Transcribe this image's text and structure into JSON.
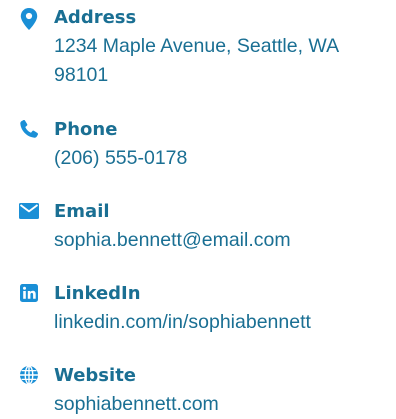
{
  "colors": {
    "accent": "#1a8fd6",
    "text": "#1a6f93",
    "background": "#ffffff"
  },
  "contacts": [
    {
      "icon": "location-pin-icon",
      "label": "Address",
      "value": "1234 Maple Avenue, Seattle, WA 98101"
    },
    {
      "icon": "phone-icon",
      "label": "Phone",
      "value": "(206) 555-0178"
    },
    {
      "icon": "envelope-icon",
      "label": "Email",
      "value": "sophia.bennett@email.com"
    },
    {
      "icon": "linkedin-icon",
      "label": "LinkedIn",
      "value": "linkedin.com/in/sophiabennett"
    },
    {
      "icon": "globe-icon",
      "label": "Website",
      "value": "sophiabennett.com"
    }
  ]
}
